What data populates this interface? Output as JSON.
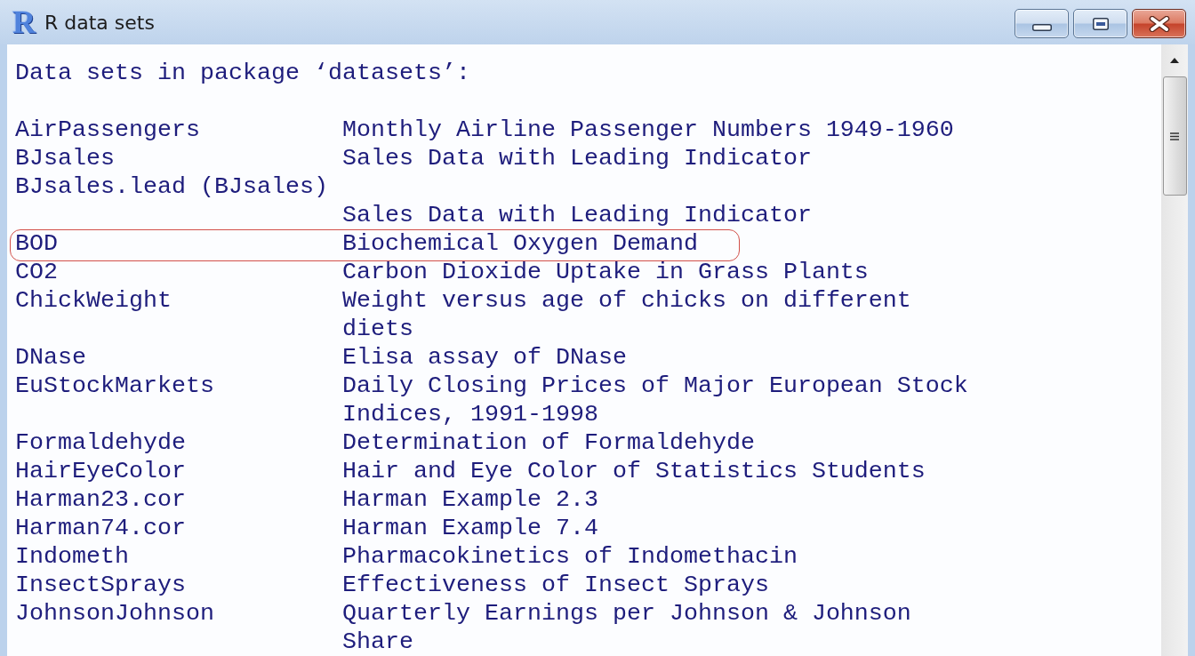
{
  "window": {
    "logo": "R",
    "title": "R data sets"
  },
  "listing": {
    "heading": "Data sets in package ‘datasets’:",
    "datasets": [
      {
        "kind": "standard",
        "name": "AirPassengers",
        "description": "Monthly Airline Passenger Numbers 1949-1960",
        "highlighted": false
      },
      {
        "kind": "standard",
        "name": "BJsales",
        "description": "Sales Data with Leading Indicator",
        "highlighted": false
      },
      {
        "kind": "wrapped_name",
        "name": "BJsales.lead (BJsales)",
        "description": "Sales Data with Leading Indicator",
        "highlighted": false
      },
      {
        "kind": "standard",
        "name": "BOD",
        "description": "Biochemical Oxygen Demand",
        "highlighted": true
      },
      {
        "kind": "standard",
        "name": "CO2",
        "description": "Carbon Dioxide Uptake in Grass Plants",
        "highlighted": false
      },
      {
        "kind": "standard",
        "name": "ChickWeight",
        "description": "Weight versus age of chicks on different diets",
        "highlighted": false
      },
      {
        "kind": "standard",
        "name": "DNase",
        "description": "Elisa assay of DNase",
        "highlighted": false
      },
      {
        "kind": "standard",
        "name": "EuStockMarkets",
        "description": "Daily Closing Prices of Major European Stock Indices, 1991-1998",
        "highlighted": false
      },
      {
        "kind": "standard",
        "name": "Formaldehyde",
        "description": "Determination of Formaldehyde",
        "highlighted": false
      },
      {
        "kind": "standard",
        "name": "HairEyeColor",
        "description": "Hair and Eye Color of Statistics Students",
        "highlighted": false
      },
      {
        "kind": "standard",
        "name": "Harman23.cor",
        "description": "Harman Example 2.3",
        "highlighted": false
      },
      {
        "kind": "standard",
        "name": "Harman74.cor",
        "description": "Harman Example 7.4",
        "highlighted": false
      },
      {
        "kind": "standard",
        "name": "Indometh",
        "description": "Pharmacokinetics of Indomethacin",
        "highlighted": false
      },
      {
        "kind": "standard",
        "name": "InsectSprays",
        "description": "Effectiveness of Insect Sprays",
        "highlighted": false
      },
      {
        "kind": "standard",
        "name": "JohnsonJohnson",
        "description": "Quarterly Earnings per Johnson & Johnson Share",
        "highlighted": false
      }
    ]
  }
}
